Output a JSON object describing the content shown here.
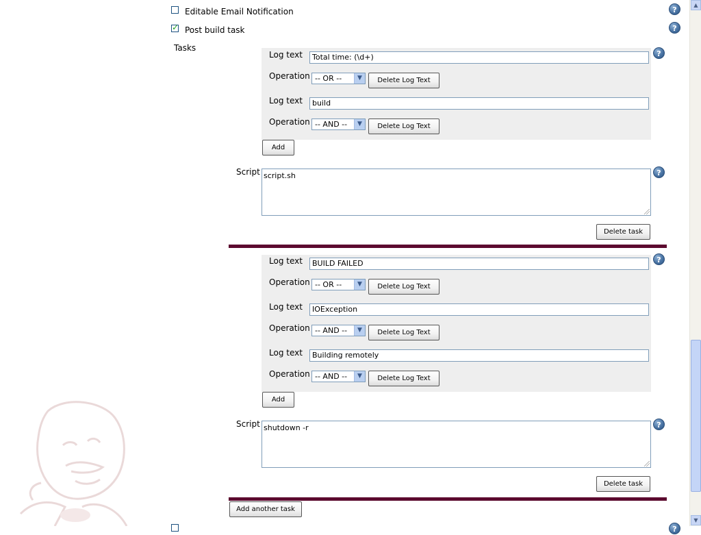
{
  "options": {
    "editable_email": {
      "label": "Editable Email Notification",
      "checked": false
    },
    "post_build_task": {
      "label": "Post build task",
      "checked": true
    }
  },
  "tasks_label": "Tasks",
  "help_glyph": "?",
  "check_glyph": "✓",
  "tasks": [
    {
      "log_entries": [
        {
          "log_label": "Log text",
          "log_value": "Total time: (\\d+)",
          "op_label": "Operation",
          "op_value": "-- OR --",
          "delete_label": "Delete Log Text"
        },
        {
          "log_label": "Log text",
          "log_value": "build",
          "op_label": "Operation",
          "op_value": "-- AND --",
          "delete_label": "Delete Log Text"
        }
      ],
      "add_label": "Add",
      "script_label": "Script",
      "script_value": "script.sh",
      "delete_task_label": "Delete task"
    },
    {
      "log_entries": [
        {
          "log_label": "Log text",
          "log_value": "BUILD FAILED",
          "op_label": "Operation",
          "op_value": "-- OR --",
          "delete_label": "Delete Log Text"
        },
        {
          "log_label": "Log text",
          "log_value": "IOException",
          "op_label": "Operation",
          "op_value": "-- AND --",
          "delete_label": "Delete Log Text"
        },
        {
          "log_label": "Log text",
          "log_value": "Building remotely",
          "op_label": "Operation",
          "op_value": "-- AND --",
          "delete_label": "Delete Log Text"
        }
      ],
      "add_label": "Add",
      "script_label": "Script",
      "script_value": "shutdown -r",
      "delete_task_label": "Delete task"
    }
  ],
  "add_another_task_label": "Add another task",
  "dropdown_arrow": "▼",
  "scroll_up": "▲",
  "scroll_down": "▼",
  "colors": {
    "separator": "#5c0a2f",
    "panel": "#eeeeee"
  }
}
